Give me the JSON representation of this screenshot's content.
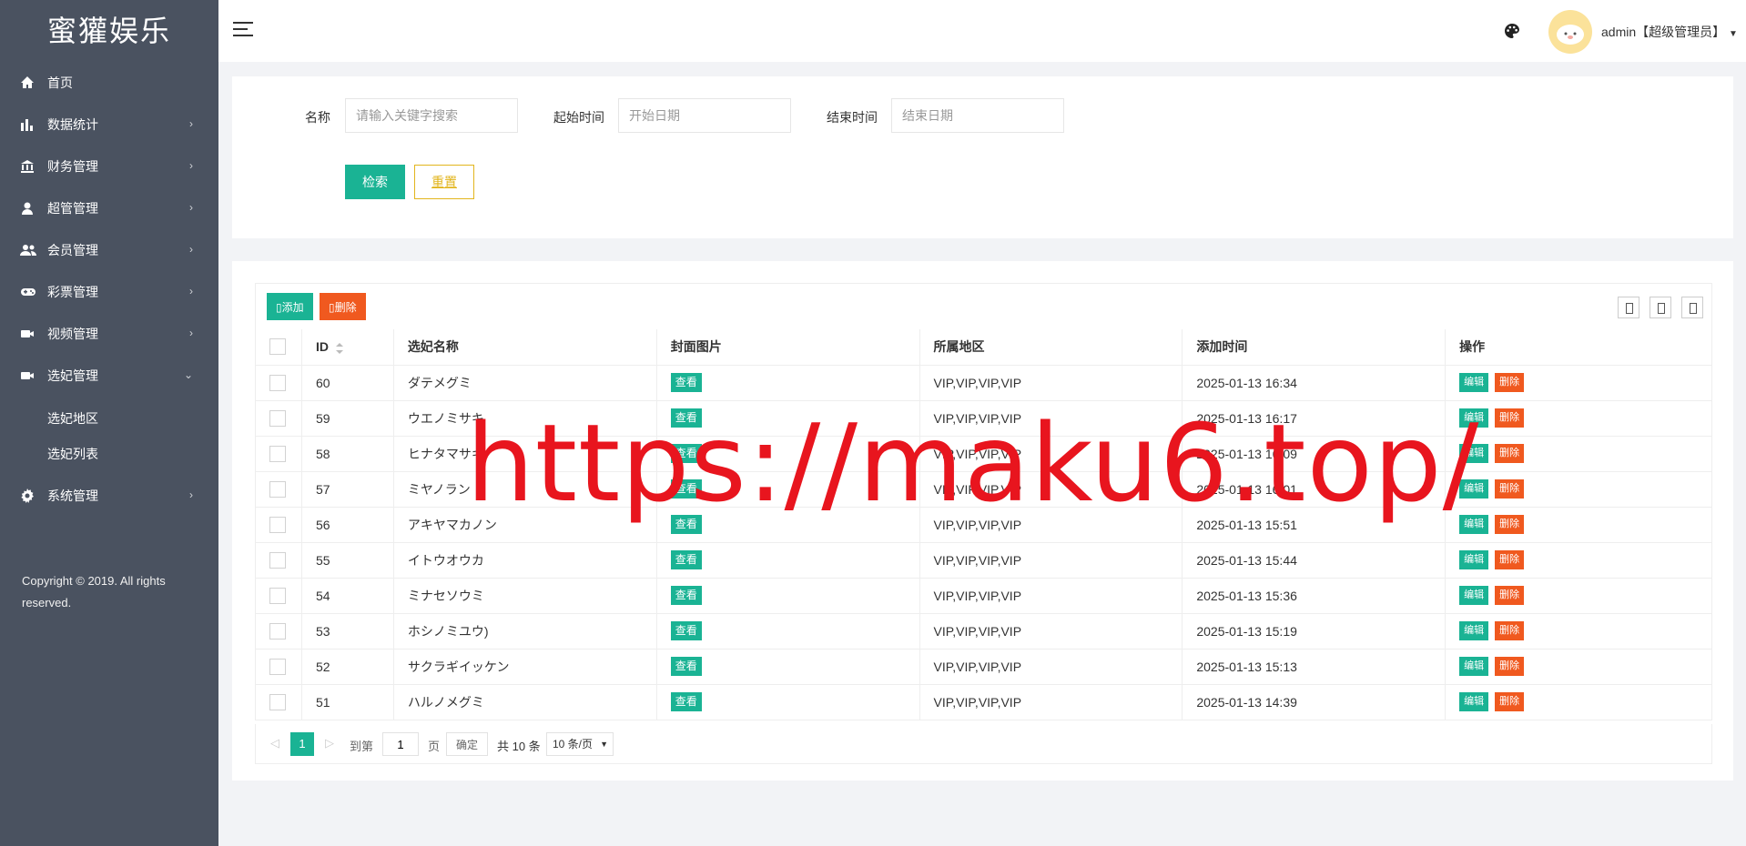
{
  "app": {
    "logo": "蜜獾娱乐"
  },
  "sidebar": {
    "items": [
      {
        "label": "首页",
        "icon": "home-icon",
        "has_arrow": false
      },
      {
        "label": "数据统计",
        "icon": "bar-chart-icon",
        "has_arrow": true
      },
      {
        "label": "财务管理",
        "icon": "bank-icon",
        "has_arrow": true
      },
      {
        "label": "超管管理",
        "icon": "user-icon",
        "has_arrow": true
      },
      {
        "label": "会员管理",
        "icon": "users-icon",
        "has_arrow": true
      },
      {
        "label": "彩票管理",
        "icon": "gamepad-icon",
        "has_arrow": true
      },
      {
        "label": "视频管理",
        "icon": "video-camera-icon",
        "has_arrow": true
      },
      {
        "label": "选妃管理",
        "icon": "video-camera-icon",
        "has_arrow": true,
        "expanded": true
      }
    ],
    "subitems": [
      {
        "label": "选妃地区"
      },
      {
        "label": "选妃列表"
      }
    ],
    "system": {
      "label": "系统管理",
      "icon": "gear-icon"
    },
    "copyright": "Copyright © 2019. All rights reserved."
  },
  "header": {
    "user": "admin【超级管理员】"
  },
  "search": {
    "name_label": "名称",
    "name_placeholder": "请输入关键字搜索",
    "start_label": "起始时间",
    "start_placeholder": "开始日期",
    "end_label": "结束时间",
    "end_placeholder": "结束日期",
    "search_button": "检索",
    "reset_button": "重置"
  },
  "toolbar": {
    "add_label": "添加",
    "delete_label": "删除",
    "add_color": "#1ab394",
    "delete_color": "#f0591f"
  },
  "table": {
    "columns": [
      "ID",
      "选妃名称",
      "封面图片",
      "所属地区",
      "添加时间",
      "操作"
    ],
    "view_label": "查看",
    "edit_label": "编辑",
    "delete_label": "删除",
    "rows": [
      {
        "id": "60",
        "name": "ダテメグミ",
        "region": "VIP,VIP,VIP,VIP",
        "time": "2025-01-13 16:34"
      },
      {
        "id": "59",
        "name": "ウエノミサキ",
        "region": "VIP,VIP,VIP,VIP",
        "time": "2025-01-13 16:17"
      },
      {
        "id": "58",
        "name": "ヒナタマサキ",
        "region": "VIP,VIP,VIP,VIP",
        "time": "2025-01-13 16:09"
      },
      {
        "id": "57",
        "name": "ミヤノラン",
        "region": "VIP,VIP,VIP,VIP",
        "time": "2025-01-13 16:01"
      },
      {
        "id": "56",
        "name": "アキヤマカノン",
        "region": "VIP,VIP,VIP,VIP",
        "time": "2025-01-13 15:51"
      },
      {
        "id": "55",
        "name": "イトウオウカ",
        "region": "VIP,VIP,VIP,VIP",
        "time": "2025-01-13 15:44"
      },
      {
        "id": "54",
        "name": "ミナセソウミ",
        "region": "VIP,VIP,VIP,VIP",
        "time": "2025-01-13 15:36"
      },
      {
        "id": "53",
        "name": "ホシノミユウ)",
        "region": "VIP,VIP,VIP,VIP",
        "time": "2025-01-13 15:19"
      },
      {
        "id": "52",
        "name": "サクラギイッケン",
        "region": "VIP,VIP,VIP,VIP",
        "time": "2025-01-13 15:13"
      },
      {
        "id": "51",
        "name": "ハルノメグミ",
        "region": "VIP,VIP,VIP,VIP",
        "time": "2025-01-13 14:39"
      }
    ]
  },
  "pagination": {
    "current_page": "1",
    "goto_label": "到第",
    "page_input": "1",
    "page_unit": "页",
    "confirm": "确定",
    "total": "共 10 条",
    "page_size": "10 条/页"
  },
  "watermark": "https://maku6.top/"
}
